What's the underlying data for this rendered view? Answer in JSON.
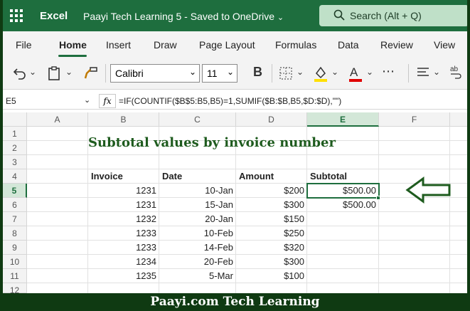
{
  "titlebar": {
    "app": "Excel",
    "document": "Paayi Tech Learning 5  -  Saved to OneDrive",
    "search_placeholder": "Search (Alt + Q)"
  },
  "tabs": [
    "File",
    "Home",
    "Insert",
    "Draw",
    "Page Layout",
    "Formulas",
    "Data",
    "Review",
    "View"
  ],
  "ribbon": {
    "font": "Calibri",
    "size": "11",
    "bold": "B"
  },
  "formula_bar": {
    "name_box": "E5",
    "fx": "fx",
    "formula": "=IF(COUNTIF($B$5:B5,B5)=1,SUMIF($B:$B,B5,$D:$D),\"\")"
  },
  "columns": [
    "A",
    "B",
    "C",
    "D",
    "E",
    "F"
  ],
  "rows": [
    "1",
    "2",
    "3",
    "4",
    "5",
    "6",
    "7",
    "8",
    "9",
    "10",
    "11",
    "12"
  ],
  "sheet_title": "Subtotal values by invoice number",
  "table": {
    "headers": [
      "Invoice",
      "Date",
      "Amount",
      "Subtotal"
    ],
    "rows": [
      [
        "1231",
        "10-Jan",
        "$200",
        "$500.00"
      ],
      [
        "1231",
        "15-Jan",
        "$300",
        "$500.00"
      ],
      [
        "1232",
        "20-Jan",
        "$150",
        ""
      ],
      [
        "1233",
        "10-Feb",
        "$250",
        ""
      ],
      [
        "1233",
        "14-Feb",
        "$320",
        ""
      ],
      [
        "1234",
        "20-Feb",
        "$300",
        ""
      ],
      [
        "1235",
        "5-Mar",
        "$100",
        ""
      ]
    ]
  },
  "footer": "Paayi.com Tech Learning",
  "colors": {
    "excel_green": "#1e6e3e",
    "title_green": "#1e5b1e",
    "footer_bg": "#0f3a12"
  }
}
